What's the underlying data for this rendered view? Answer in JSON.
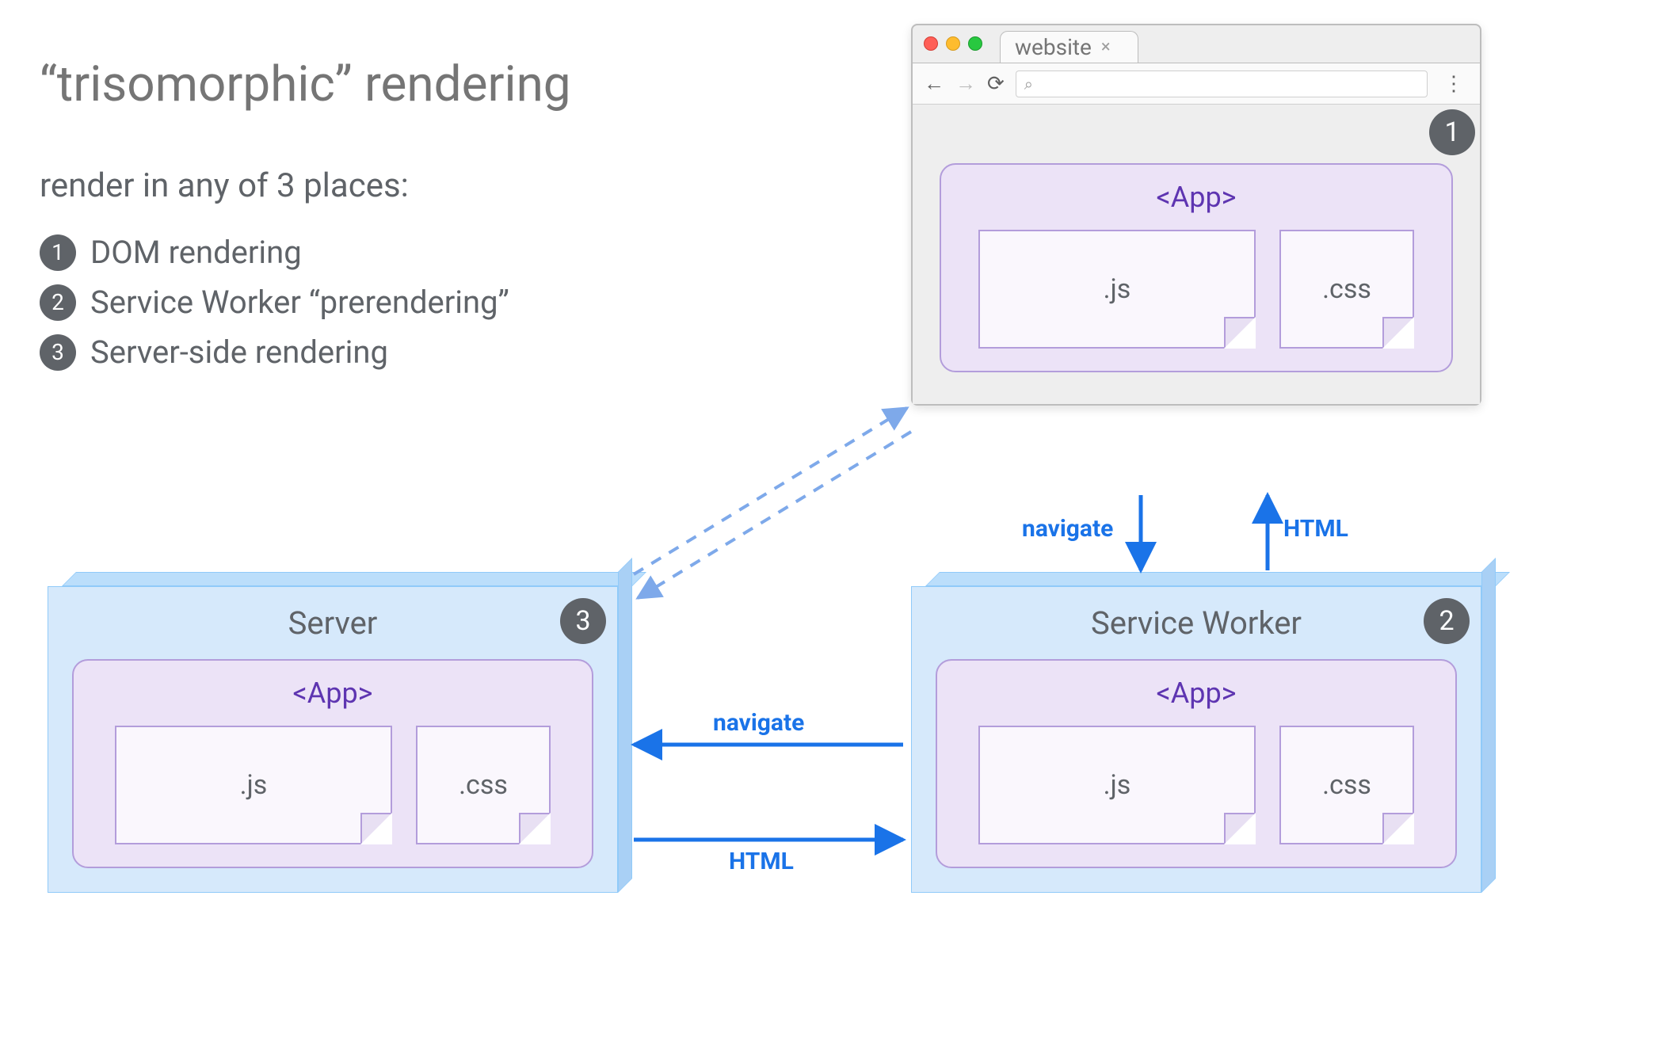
{
  "title": "“trisomorphic” rendering",
  "subtitle": "render in any of 3 places:",
  "list": [
    {
      "n": "1",
      "text": "DOM rendering"
    },
    {
      "n": "2",
      "text": "Service Worker “prerendering”"
    },
    {
      "n": "3",
      "text": "Server-side rendering"
    }
  ],
  "browser": {
    "tab_label": "website",
    "badge": "1",
    "app": {
      "label": "<App>",
      "js": ".js",
      "css": ".css"
    }
  },
  "server": {
    "title": "Server",
    "badge": "3",
    "app": {
      "label": "<App>",
      "js": ".js",
      "css": ".css"
    }
  },
  "service_worker": {
    "title": "Service Worker",
    "badge": "2",
    "app": {
      "label": "<App>",
      "js": ".js",
      "css": ".css"
    }
  },
  "arrows": {
    "browser_sw_down": "navigate",
    "browser_sw_up": "HTML",
    "sw_server_left": "navigate",
    "sw_server_right": "HTML"
  },
  "colors": {
    "text_muted": "#5f6368",
    "panel_blue": "#d6e9fb",
    "panel_blue_border": "#90caf9",
    "app_purple": "#ece3f7",
    "app_purple_border": "#b39ddb",
    "app_purple_text": "#5e35b1",
    "arrow_blue": "#1a73e8",
    "badge_gray": "#5f6368"
  }
}
